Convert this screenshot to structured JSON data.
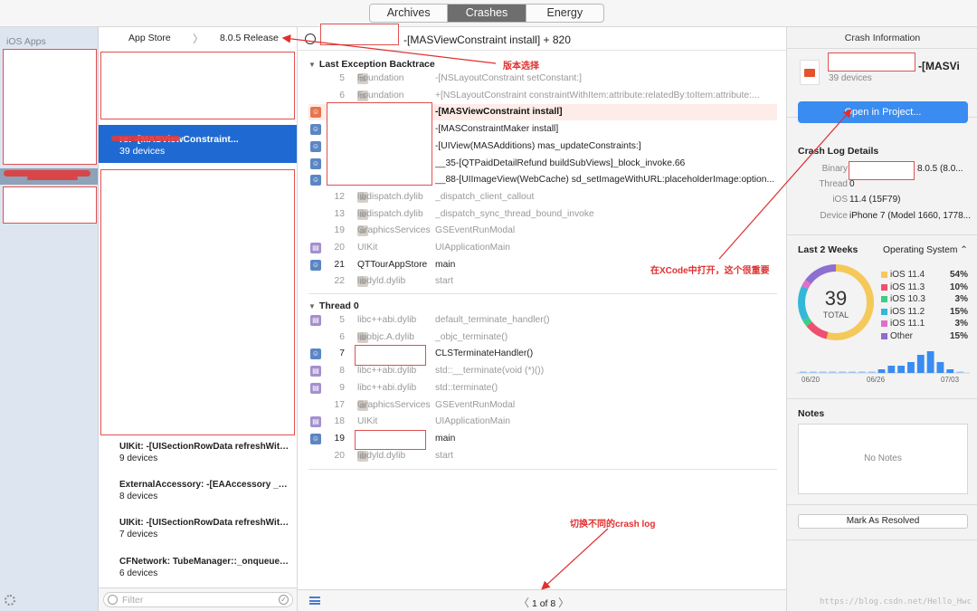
{
  "tabs": [
    {
      "label": "Archives",
      "active": false
    },
    {
      "label": "Crashes",
      "active": true
    },
    {
      "label": "Energy",
      "active": false
    }
  ],
  "apps": {
    "title": "iOS Apps"
  },
  "list": {
    "crumb_app": "App Store",
    "crumb_sep": "〉",
    "crumb_version": "8.0.5 Release",
    "selected": {
      "title": "re: -[MASViewConstraint...",
      "devices": "39 devices"
    },
    "items": [
      {
        "title": "UIKit: -[UISectionRowData refreshWith...",
        "devices": "9 devices"
      },
      {
        "title": "ExternalAccessory: -[EAAccessory _end...",
        "devices": "8 devices"
      },
      {
        "title": "UIKit: -[UISectionRowData refreshWith...",
        "devices": "7 devices"
      },
      {
        "title": "CFNetwork: TubeManager::_onqueue_e...",
        "devices": "6 devices"
      }
    ],
    "filter_placeholder": "Filter"
  },
  "trace": {
    "title": "-[MASViewConstraint install] + 820",
    "exception_title": "Last Exception Backtrace",
    "exception_frames": [
      {
        "num": "5",
        "lib": "Foundation",
        "sym": "-[NSLayoutConstraint setConstant:]",
        "kind": "lib",
        "style": "dim"
      },
      {
        "num": "6",
        "lib": "Foundation",
        "sym": "+[NSLayoutConstraint constraintWithItem:attribute:relatedBy:toItem:attribute:...",
        "kind": "lib",
        "style": "dim"
      },
      {
        "num": "",
        "lib": "",
        "sym": "-[MASViewConstraint install]",
        "kind": "crash",
        "style": "bold"
      },
      {
        "num": "",
        "lib": "",
        "sym": "-[MASConstraintMaker install]",
        "kind": "user",
        "style": "dark"
      },
      {
        "num": "",
        "lib": "",
        "sym": "-[UIView(MASAdditions) mas_updateConstraints:]",
        "kind": "user",
        "style": "dark"
      },
      {
        "num": "",
        "lib": "",
        "sym": "__35-[QTPaidDetailRefund buildSubViews]_block_invoke.66",
        "kind": "user",
        "style": "dark"
      },
      {
        "num": "",
        "lib": "",
        "sym": "__88-[UIImageView(WebCache) sd_setImageWithURL:placeholderImage:option...",
        "kind": "user",
        "style": "dark"
      },
      {
        "num": "12",
        "lib": "libdispatch.dylib",
        "sym": "_dispatch_client_callout",
        "kind": "lib",
        "style": "dim"
      },
      {
        "num": "13",
        "lib": "libdispatch.dylib",
        "sym": "_dispatch_sync_thread_bound_invoke",
        "kind": "lib",
        "style": "dim"
      },
      {
        "num": "19",
        "lib": "GraphicsServices",
        "sym": "GSEventRunModal",
        "kind": "lib",
        "style": "dim"
      },
      {
        "num": "20",
        "lib": "UIKit",
        "sym": "UIApplicationMain",
        "kind": "purple",
        "style": "dim"
      },
      {
        "num": "21",
        "lib": "QTTourAppStore",
        "sym": "main",
        "kind": "user",
        "style": "dark"
      },
      {
        "num": "22",
        "lib": "libdyld.dylib",
        "sym": "start",
        "kind": "lib",
        "style": "dim"
      }
    ],
    "thread_title": "Thread 0",
    "thread_frames": [
      {
        "num": "5",
        "lib": "libc++abi.dylib",
        "sym": "default_terminate_handler()",
        "kind": "purple",
        "style": "dim"
      },
      {
        "num": "6",
        "lib": "libobjc.A.dylib",
        "sym": "_objc_terminate()",
        "kind": "lib",
        "style": "dim"
      },
      {
        "num": "7",
        "lib": "",
        "sym": "CLSTerminateHandler()",
        "kind": "user",
        "style": "dark"
      },
      {
        "num": "8",
        "lib": "libc++abi.dylib",
        "sym": "std::__terminate(void (*)())",
        "kind": "purple",
        "style": "dim"
      },
      {
        "num": "9",
        "lib": "libc++abi.dylib",
        "sym": "std::terminate()",
        "kind": "purple",
        "style": "dim"
      },
      {
        "num": "17",
        "lib": "GraphicsServices",
        "sym": "GSEventRunModal",
        "kind": "lib",
        "style": "dim"
      },
      {
        "num": "18",
        "lib": "UIKit",
        "sym": "UIApplicationMain",
        "kind": "purple",
        "style": "dim"
      },
      {
        "num": "19",
        "lib": "",
        "sym": "main",
        "kind": "user",
        "style": "dark"
      },
      {
        "num": "20",
        "lib": "libdyld.dylib",
        "sym": "start",
        "kind": "lib",
        "style": "dim"
      }
    ],
    "pager_prev": "〈",
    "pager_text": "1 of 8",
    "pager_next": "〉"
  },
  "annotations": {
    "version": "版本选择",
    "xcode": "在XCode中打开，这个很重要",
    "switch": "切换不同的crash log",
    "watermark": "https://blog.csdn.net/Hello_Hwc"
  },
  "info": {
    "title": "Crash Information",
    "app_name": "-[MASVi",
    "app_devices": "39 devices",
    "open_button": "Open in Project...",
    "details_title": "Crash Log Details",
    "binary_label": "Binary",
    "binary_value": "8.0.5 (8.0...",
    "thread_label": "Thread",
    "thread_value": "0",
    "ios_label": "iOS",
    "ios_value": "11.4 (15F79)",
    "device_label": "Device",
    "device_value": "iPhone 7 (Model 1660, 1778...",
    "period_title": "Last 2 Weeks",
    "os_selector": "Operating System ⌃",
    "total_value": "39",
    "total_label": "TOTAL",
    "legend": [
      {
        "name": "iOS 11.4",
        "pct": "54%",
        "color": "#f5c85a"
      },
      {
        "name": "iOS 11.3",
        "pct": "10%",
        "color": "#ef4f6e"
      },
      {
        "name": "iOS 10.3",
        "pct": "3%",
        "color": "#3ecc8a"
      },
      {
        "name": "iOS 11.2",
        "pct": "15%",
        "color": "#34b7d9"
      },
      {
        "name": "iOS 11.1",
        "pct": "3%",
        "color": "#e06fc9"
      },
      {
        "name": "Other",
        "pct": "15%",
        "color": "#8d6fd0"
      }
    ],
    "spark_dates": [
      "06/20",
      "06/26",
      "07/03"
    ],
    "notes_title": "Notes",
    "notes_empty": "No Notes",
    "resolve_button": "Mark As Resolved"
  },
  "chart_data": {
    "type": "pie",
    "title": "Last 2 Weeks",
    "categories": [
      "iOS 11.4",
      "iOS 11.3",
      "iOS 10.3",
      "iOS 11.2",
      "iOS 11.1",
      "Other"
    ],
    "values": [
      54,
      10,
      3,
      15,
      3,
      15
    ],
    "total": 39,
    "bars": {
      "x": [
        "06/20",
        "06/26",
        "07/03"
      ],
      "values": [
        0,
        0,
        0,
        0,
        0,
        0,
        0,
        0,
        1,
        2,
        2,
        3,
        5,
        6,
        3,
        1,
        0
      ]
    }
  }
}
